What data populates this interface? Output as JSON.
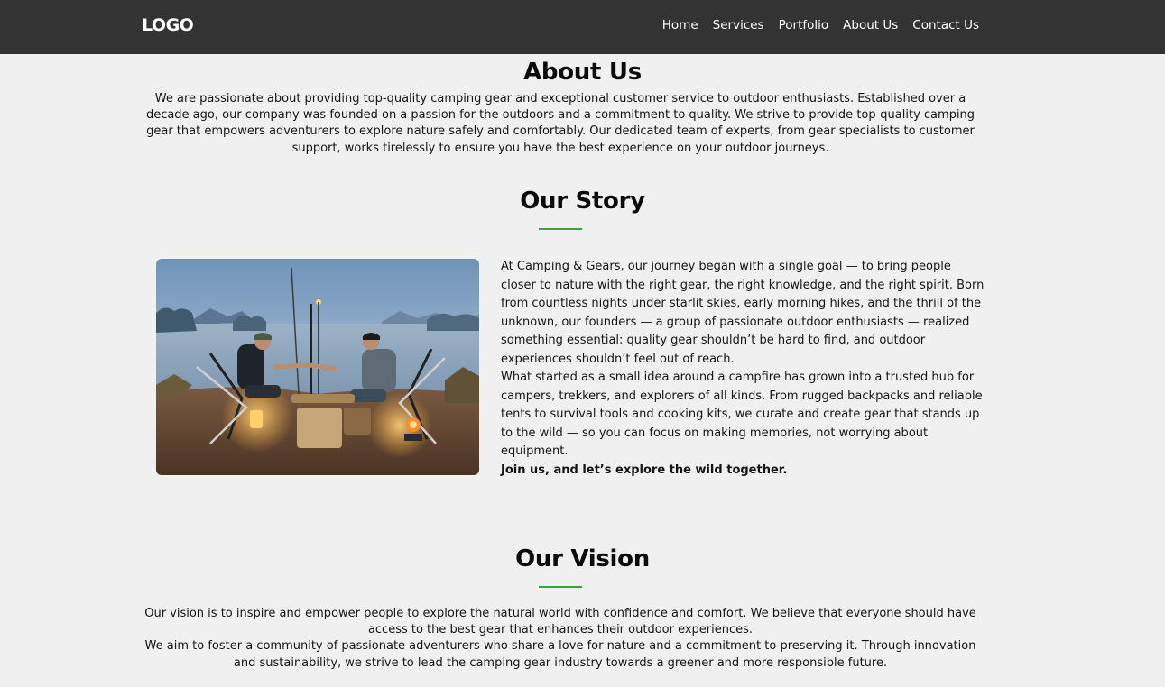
{
  "navbar": {
    "logo": "LOGO",
    "links": [
      "Home",
      "Services",
      "Portfolio",
      "About Us",
      "Contact Us"
    ]
  },
  "about": {
    "title": "About Us",
    "text": "We are passionate about providing top-quality camping gear and exceptional customer service to outdoor enthusiasts. Established over a decade ago, our company was founded on a passion for the outdoors and a commitment to quality. We strive to provide top-quality camping gear that empowers adventurers to explore nature safely and comfortably. Our dedicated team of experts, from gear specialists to customer support, works tirelessly to ensure you have the best experience on your outdoor journeys."
  },
  "story": {
    "title": "Our Story",
    "paragraph1": "At Camping & Gears, our journey began with a single goal — to bring people closer to nature with the right gear, the right knowledge, and the right spirit. Born from countless nights under starlit skies, early morning hikes, and the thrill of the unknown, our founders — a group of passionate outdoor enthusiasts — realized something essential: quality gear shouldn’t be hard to find, and outdoor experiences shouldn’t feel out of reach.",
    "paragraph2": "What started as a small idea around a campfire has grown into a trusted hub for campers, trekkers, and explorers of all kinds. From rugged backpacks and reliable tents to survival tools and cooking kits, we curate and create gear that stands up to the wild — so you can focus on making memories, not worrying about equipment.",
    "cta": "Join us, and let’s explore the wild together."
  },
  "vision": {
    "title": "Our Vision",
    "paragraph1": "Our vision is to inspire and empower people to explore the natural world with confidence and comfort. We believe that everyone should have access to the best gear that enhances their outdoor experiences.",
    "paragraph2": "We aim to foster a community of passionate adventurers who share a love for nature and a commitment to preserving it. Through innovation and sustainability, we strive to lead the camping gear industry towards a greener and more responsible future."
  },
  "colors": {
    "navbar_bg": "#333333",
    "page_bg": "#f0f0f0",
    "accent_underline": "#3aa23a"
  }
}
